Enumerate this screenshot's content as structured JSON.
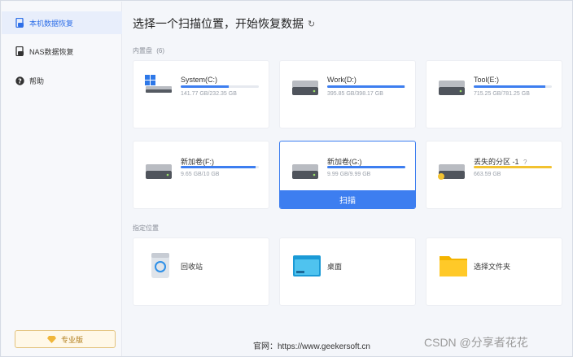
{
  "sidebar": {
    "items": [
      {
        "label": "本机数据恢复",
        "icon": "drive-file-icon",
        "active": true
      },
      {
        "label": "NAS数据恢复",
        "icon": "nas-icon",
        "active": false
      },
      {
        "label": "帮助",
        "icon": "help-icon",
        "active": false
      }
    ],
    "pro_label": "专业版"
  },
  "main": {
    "title": "选择一个扫描位置，开始恢复数据",
    "refresh_icon": "↻",
    "internal_label": "内置盘",
    "internal_count": "(6)",
    "drives": [
      {
        "name": "System(C:)",
        "size": "141.77 GB/232.35 GB",
        "usage": 0.61,
        "icon": "windows-drive-icon"
      },
      {
        "name": "Work(D:)",
        "size": "395.85 GB/398.17 GB",
        "usage": 0.99,
        "icon": "hard-drive-icon"
      },
      {
        "name": "Tool(E:)",
        "size": "715.25 GB/781.25 GB",
        "usage": 0.92,
        "icon": "hard-drive-icon"
      },
      {
        "name": "新加卷(F:)",
        "size": "9.65 GB/10 GB",
        "usage": 0.96,
        "icon": "hard-drive-icon"
      },
      {
        "name": "新加卷(G:)",
        "size": "9.99 GB/9.99 GB",
        "usage": 1.0,
        "icon": "hard-drive-icon"
      },
      {
        "name": "丢失的分区 -1",
        "size": "663.59 GB",
        "usage": 1.0,
        "icon": "lost-partition-icon"
      }
    ],
    "scan_label": "扫描",
    "locations_label": "指定位置",
    "locations": [
      {
        "name": "回收站",
        "icon": "recycle-bin-icon"
      },
      {
        "name": "桌面",
        "icon": "desktop-folder-icon"
      },
      {
        "name": "选择文件夹",
        "icon": "folder-icon"
      }
    ]
  },
  "footer": {
    "text": "官网：https://www.geekersoft.cn"
  },
  "watermark": "CSDN @分享者花花",
  "colors": {
    "accent": "#3d7ef0",
    "lost": "#f2c230",
    "pro": "#b07b18"
  }
}
